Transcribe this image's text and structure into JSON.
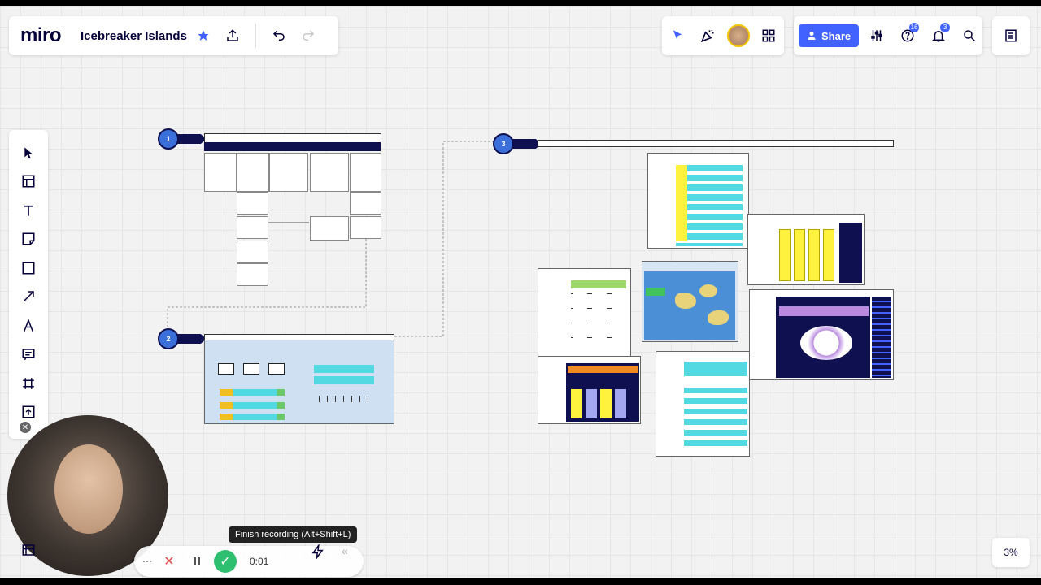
{
  "app": {
    "logo": "miro",
    "board_title": "Icebreaker Islands"
  },
  "header": {
    "star_icon": "star-icon",
    "export_icon": "upload-icon",
    "undo_icon": "undo-icon",
    "redo_icon": "redo-icon",
    "share_label": "Share",
    "notifications_badge": "3",
    "help_badge": "16"
  },
  "toolbar": {
    "tools": [
      "select-tool",
      "templates-tool",
      "text-tool",
      "sticky-note-tool",
      "shape-tool",
      "line-tool",
      "pen-tool",
      "comment-tool",
      "frame-tool",
      "upload-tool"
    ]
  },
  "board": {
    "step1": "1",
    "step2": "2",
    "step3": "3"
  },
  "recording": {
    "tooltip": "Finish recording (Alt+Shift+L)",
    "timer": "0:01"
  },
  "zoom": {
    "level": "3%"
  },
  "colors": {
    "accent": "#4262ff",
    "navy": "#0e1050",
    "yellow": "#fff23e",
    "cyan": "#52d9e1"
  }
}
